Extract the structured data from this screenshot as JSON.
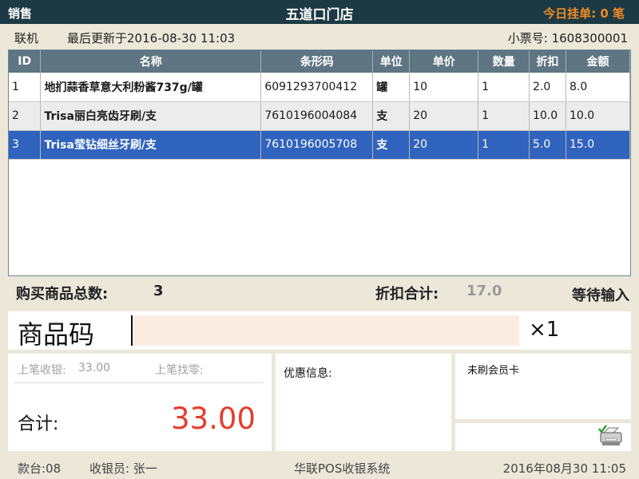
{
  "titlebar": {
    "mode": "销售",
    "store": "五道口门店",
    "held_label": "今日挂单:",
    "held_count": "0",
    "held_unit": "笔"
  },
  "infobar": {
    "status": "联机",
    "updated_label": "最后更新于",
    "updated_time": "2016-08-30 11:03",
    "receipt_label": "小票号:",
    "receipt_no": "1608300001"
  },
  "table": {
    "columns": [
      "ID",
      "名称",
      "条形码",
      "单位",
      "单价",
      "数量",
      "折扣",
      "金额"
    ],
    "rows": [
      {
        "id": "1",
        "name": "地扪蒜香草意大利粉酱737g/罐",
        "barcode": "6091293700412",
        "unit": "罐",
        "price": "10",
        "qty": "1",
        "discount": "2.0",
        "amount": "8.0"
      },
      {
        "id": "2",
        "name": "Trisa丽白亮齿牙刷/支",
        "barcode": "7610196004084",
        "unit": "支",
        "price": "20",
        "qty": "1",
        "discount": "10.0",
        "amount": "10.0"
      },
      {
        "id": "3",
        "name": "Trisa莹钻细丝牙刷/支",
        "barcode": "7610196005708",
        "unit": "支",
        "price": "20",
        "qty": "1",
        "discount": "5.0",
        "amount": "15.0"
      }
    ],
    "selected_row": 2
  },
  "summary": {
    "count_label": "购买商品总数:",
    "count_value": "3",
    "discount_label": "折扣合计:",
    "discount_value": "17.0",
    "status": "等待输入"
  },
  "input": {
    "label": "商品码",
    "value": "",
    "qty": "×1"
  },
  "totals": {
    "last_received_label": "上笔收银:",
    "last_received_value": "33.00",
    "last_change_label": "上笔找零:",
    "last_change_value": "",
    "total_label": "合计:",
    "total_value": "33.00"
  },
  "promo": {
    "label": "优惠信息:"
  },
  "member": {
    "label": "未刷会员卡"
  },
  "footer": {
    "till": "款台:08",
    "cashier": "收银员: 张一",
    "system": "华联POS收银系统",
    "datetime": "2016年08月30 11:05"
  },
  "colors": {
    "titlebar": "#1c3a43",
    "accent_orange": "#f08a24",
    "selected_row": "#2f63bd",
    "total_red": "#e63c2d",
    "header_grey": "#5f7581"
  }
}
